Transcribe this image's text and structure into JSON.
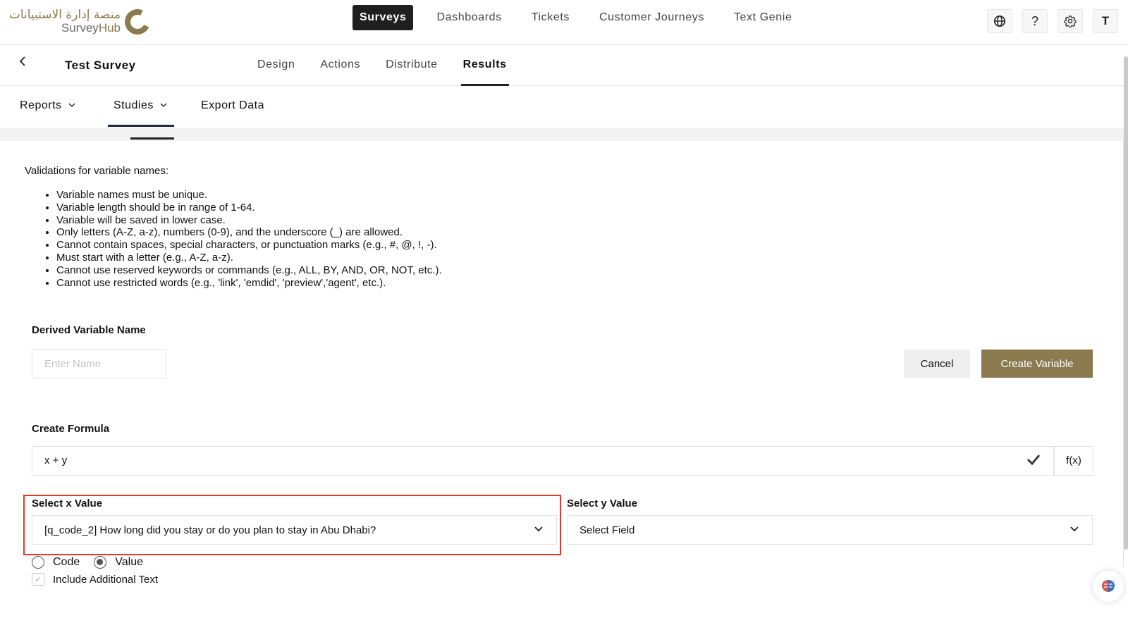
{
  "logo": {
    "arabic": "منصة إدارة الاستبيانات",
    "survey": "Survey",
    "hub": "Hub"
  },
  "nav": {
    "items": [
      "Surveys",
      "Dashboards",
      "Tickets",
      "Customer Journeys",
      "Text Genie"
    ],
    "active": "Surveys"
  },
  "top_icons": {
    "globe": "globe-icon",
    "help": "?",
    "settings": "gear-icon",
    "avatar": "T"
  },
  "survey": {
    "title": "Test Survey",
    "tabs": [
      "Design",
      "Actions",
      "Distribute",
      "Results"
    ],
    "active_tab": "Results"
  },
  "subtabs": {
    "reports": "Reports",
    "studies": "Studies",
    "export": "Export Data"
  },
  "validations": {
    "title": "Validations for variable names:",
    "rules": [
      "Variable names must be unique.",
      "Variable length should be in range of 1-64.",
      "Variable will be saved in lower case.",
      "Only letters (A-Z, a-z), numbers (0-9), and the underscore (_) are allowed.",
      "Cannot contain spaces, special characters, or punctuation marks (e.g., #, @, !, -).",
      "Must start with a letter (e.g., A-Z, a-z).",
      "Cannot use reserved keywords or commands (e.g., ALL, BY, AND, OR, NOT, etc.).",
      "Cannot use restricted words (e.g., 'link', 'emdid', 'preview','agent', etc.)."
    ]
  },
  "form": {
    "name_label": "Derived Variable Name",
    "name_placeholder": "Enter Name",
    "cancel": "Cancel",
    "create": "Create Variable",
    "formula_label": "Create Formula",
    "formula_value": "x + y",
    "fx": "f(x)",
    "x_label": "Select x Value",
    "x_value": "[q_code_2] How long did you stay or do you plan to stay in Abu Dhabi?",
    "y_label": "Select y Value",
    "y_value": "Select Field",
    "radio_code": "Code",
    "radio_value": "Value",
    "radio_selected": "Value",
    "include_text": "Include Additional Text"
  },
  "colors": {
    "brand": "#8a7a4e",
    "highlight": "#e0392b",
    "nav_active": "#1f1f1f"
  }
}
